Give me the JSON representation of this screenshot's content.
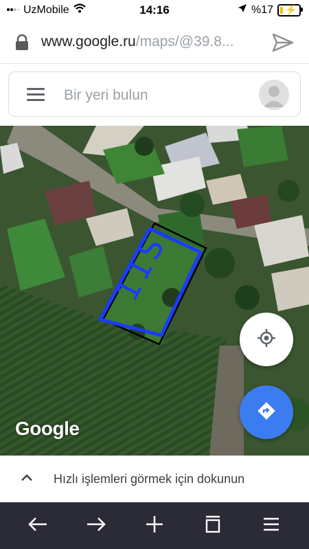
{
  "status_bar": {
    "carrier": "UzMobile",
    "time": "14:16",
    "battery_prefix": "%",
    "battery_level": "17",
    "battery_fraction": 0.17
  },
  "browser": {
    "url_domain": "www.google.ru",
    "url_path": "/maps/@39.8..."
  },
  "maps": {
    "search_placeholder": "Bir yeri bulun",
    "logo_text": "Google",
    "bottom_sheet_text": "Hızlı işlemleri görmek için dokunun",
    "annotation_text": "11S"
  },
  "colors": {
    "accent_blue": "#3b7df0",
    "toolbar_bg": "#2b2b38",
    "annotation_blue": "#1a3cff"
  },
  "icons": {
    "wifi": "wifi-icon",
    "location": "location-arrow-icon",
    "lock": "lock-icon",
    "share": "share-icon",
    "menu": "hamburger-menu-icon",
    "avatar": "avatar-icon",
    "locate": "my-location-icon",
    "directions": "directions-icon",
    "expand": "chevron-up-icon",
    "back": "back-arrow-icon",
    "forward": "forward-arrow-icon",
    "new_tab": "plus-icon",
    "tabs": "tabs-icon",
    "browser_menu": "menu-icon"
  }
}
